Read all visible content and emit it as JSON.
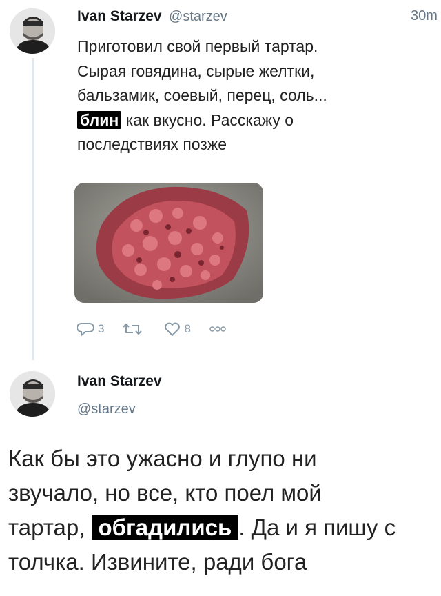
{
  "tweet1": {
    "author_name": "Ivan Starzev",
    "author_handle": "@starzev",
    "time": "30m",
    "text_line1": "Приготовил свой первый тартар.",
    "text_line2": "Сырая говядина, сырые желтки,",
    "text_line3": "бальзамик, соевый, перец, соль...",
    "censored_word": "блин",
    "text_line4_rest": " как вкусно. Расскажу о",
    "text_line5": "последствиях позже",
    "reply_count": "3",
    "retweet_count": "",
    "like_count": "8",
    "icons": [
      "reply-icon",
      "retweet-icon",
      "like-icon",
      "more-icon"
    ]
  },
  "tweet2": {
    "author_name": "Ivan Starzev",
    "author_handle": "@starzev",
    "text_line1": "Как бы это ужасно и глупо ни",
    "text_line2": "звучало, но все, кто поел мой",
    "text_line3_start": "тартар, ",
    "censored_word": "обгадились",
    "text_line3_end": ". Да и я пишу с",
    "text_line4": "толчка. Извините, ради бога"
  },
  "colors": {
    "text": "#14171a",
    "secondary": "#657786",
    "action": "#8899a6",
    "thread_line": "#e1e8ed",
    "censor_bg": "#000000"
  }
}
